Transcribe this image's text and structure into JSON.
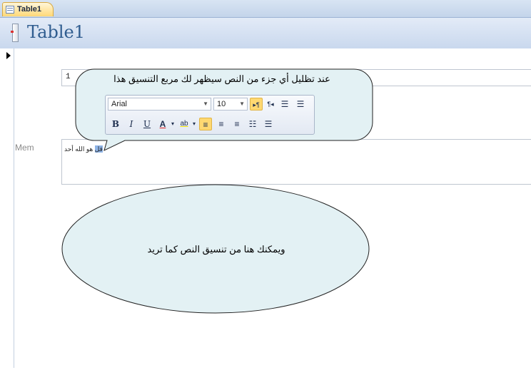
{
  "tab": {
    "label": "Table1"
  },
  "header": {
    "title": "Table1"
  },
  "form": {
    "id_value": "1",
    "mem_label": "Mem",
    "mem_text_selected": "قل",
    "mem_text_rest": " هو الله أحد"
  },
  "callout": {
    "text": "عند تظليل أي جزء من النص سيظهر لك مربع التنسيق هذا"
  },
  "mini_toolbar": {
    "font_name": "Arial",
    "font_size": "10",
    "bold": "B",
    "italic": "I",
    "underline": "U",
    "font_color": "A",
    "highlight": "ab",
    "icons": [
      "ltr-direction-icon",
      "rtl-direction-icon",
      "decrease-indent-icon",
      "increase-indent-icon",
      "font-color-icon",
      "highlight-icon",
      "align-left-icon",
      "align-center-icon",
      "align-right-icon",
      "numbered-list-icon",
      "bullet-list-icon"
    ]
  },
  "note": {
    "text": "ويمكنك هنا من تنسيق النص كما تريد"
  },
  "colors": {
    "title": "#2f5c8f",
    "tab_active": "#ffd877",
    "callout_fill": "#e3f1f4",
    "ellipse_fill": "#e3f1f4"
  }
}
